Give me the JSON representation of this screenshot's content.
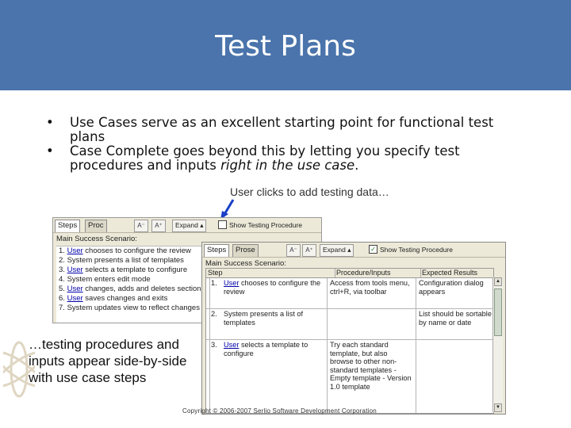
{
  "slide": {
    "title": "Test Plans",
    "bullets": [
      {
        "text": "Use Cases serve as an excellent starting point for functional test plans"
      },
      {
        "text_before": "Case Complete goes beyond this by letting you specify test procedures and inputs ",
        "emphasis": "right in the use case",
        "text_after": "."
      }
    ],
    "bullet_char": "•",
    "callout_top": "User clicks to add testing data…",
    "callout_left": [
      "…testing procedures and",
      "inputs appear side-by-side",
      "with use case steps"
    ],
    "copyright": "Copyright © 2006-2007 Serlio Software Development Corporation",
    "colors": {
      "header": "#4a74ab",
      "arrow": "#1a3fc8"
    }
  },
  "back_window": {
    "tabs": [
      "Steps",
      "Proc"
    ],
    "expand_label": "Expand",
    "show_testing_label": "Show Testing Procedure",
    "scenario_label": "Main Success Scenario:",
    "steps": [
      {
        "num": "1.",
        "actor": "User",
        "text": " chooses to configure the review"
      },
      {
        "num": "2.",
        "actor": "",
        "text": "System presents a list of templates"
      },
      {
        "num": "3.",
        "actor": "User",
        "text": " selects a template to configure"
      },
      {
        "num": "4.",
        "actor": "",
        "text": "System enters edit mode"
      },
      {
        "num": "5.",
        "actor": "User",
        "text": " changes, adds and deletes sections"
      },
      {
        "num": "6.",
        "actor": "User",
        "text": " saves changes and exits"
      },
      {
        "num": "7.",
        "actor": "",
        "text": "System updates view to reflect changes"
      }
    ]
  },
  "front_window": {
    "tabs": [
      "Steps",
      "Prose"
    ],
    "expand_label": "Expand",
    "show_testing_label": "Show Testing Procedure",
    "scenario_label": "Main Success Scenario:",
    "columns": [
      "Step",
      "Procedure/Inputs",
      "Expected Results"
    ],
    "rows": [
      {
        "num": "1.",
        "actor": "User",
        "step": " chooses to configure the review",
        "procedure": "Access from tools menu, ctrl+R, via toolbar",
        "expected": "Configuration dialog appears"
      },
      {
        "num": "2.",
        "actor": "",
        "step": "System presents a list of templates",
        "procedure": "",
        "expected": "List should be sortable by name or date"
      },
      {
        "num": "3.",
        "actor": "User",
        "step": " selects a template to configure",
        "procedure": "Try each standard template, but also browse to other non-standard templates - Empty template - Version 1.0 template",
        "expected": ""
      }
    ]
  }
}
